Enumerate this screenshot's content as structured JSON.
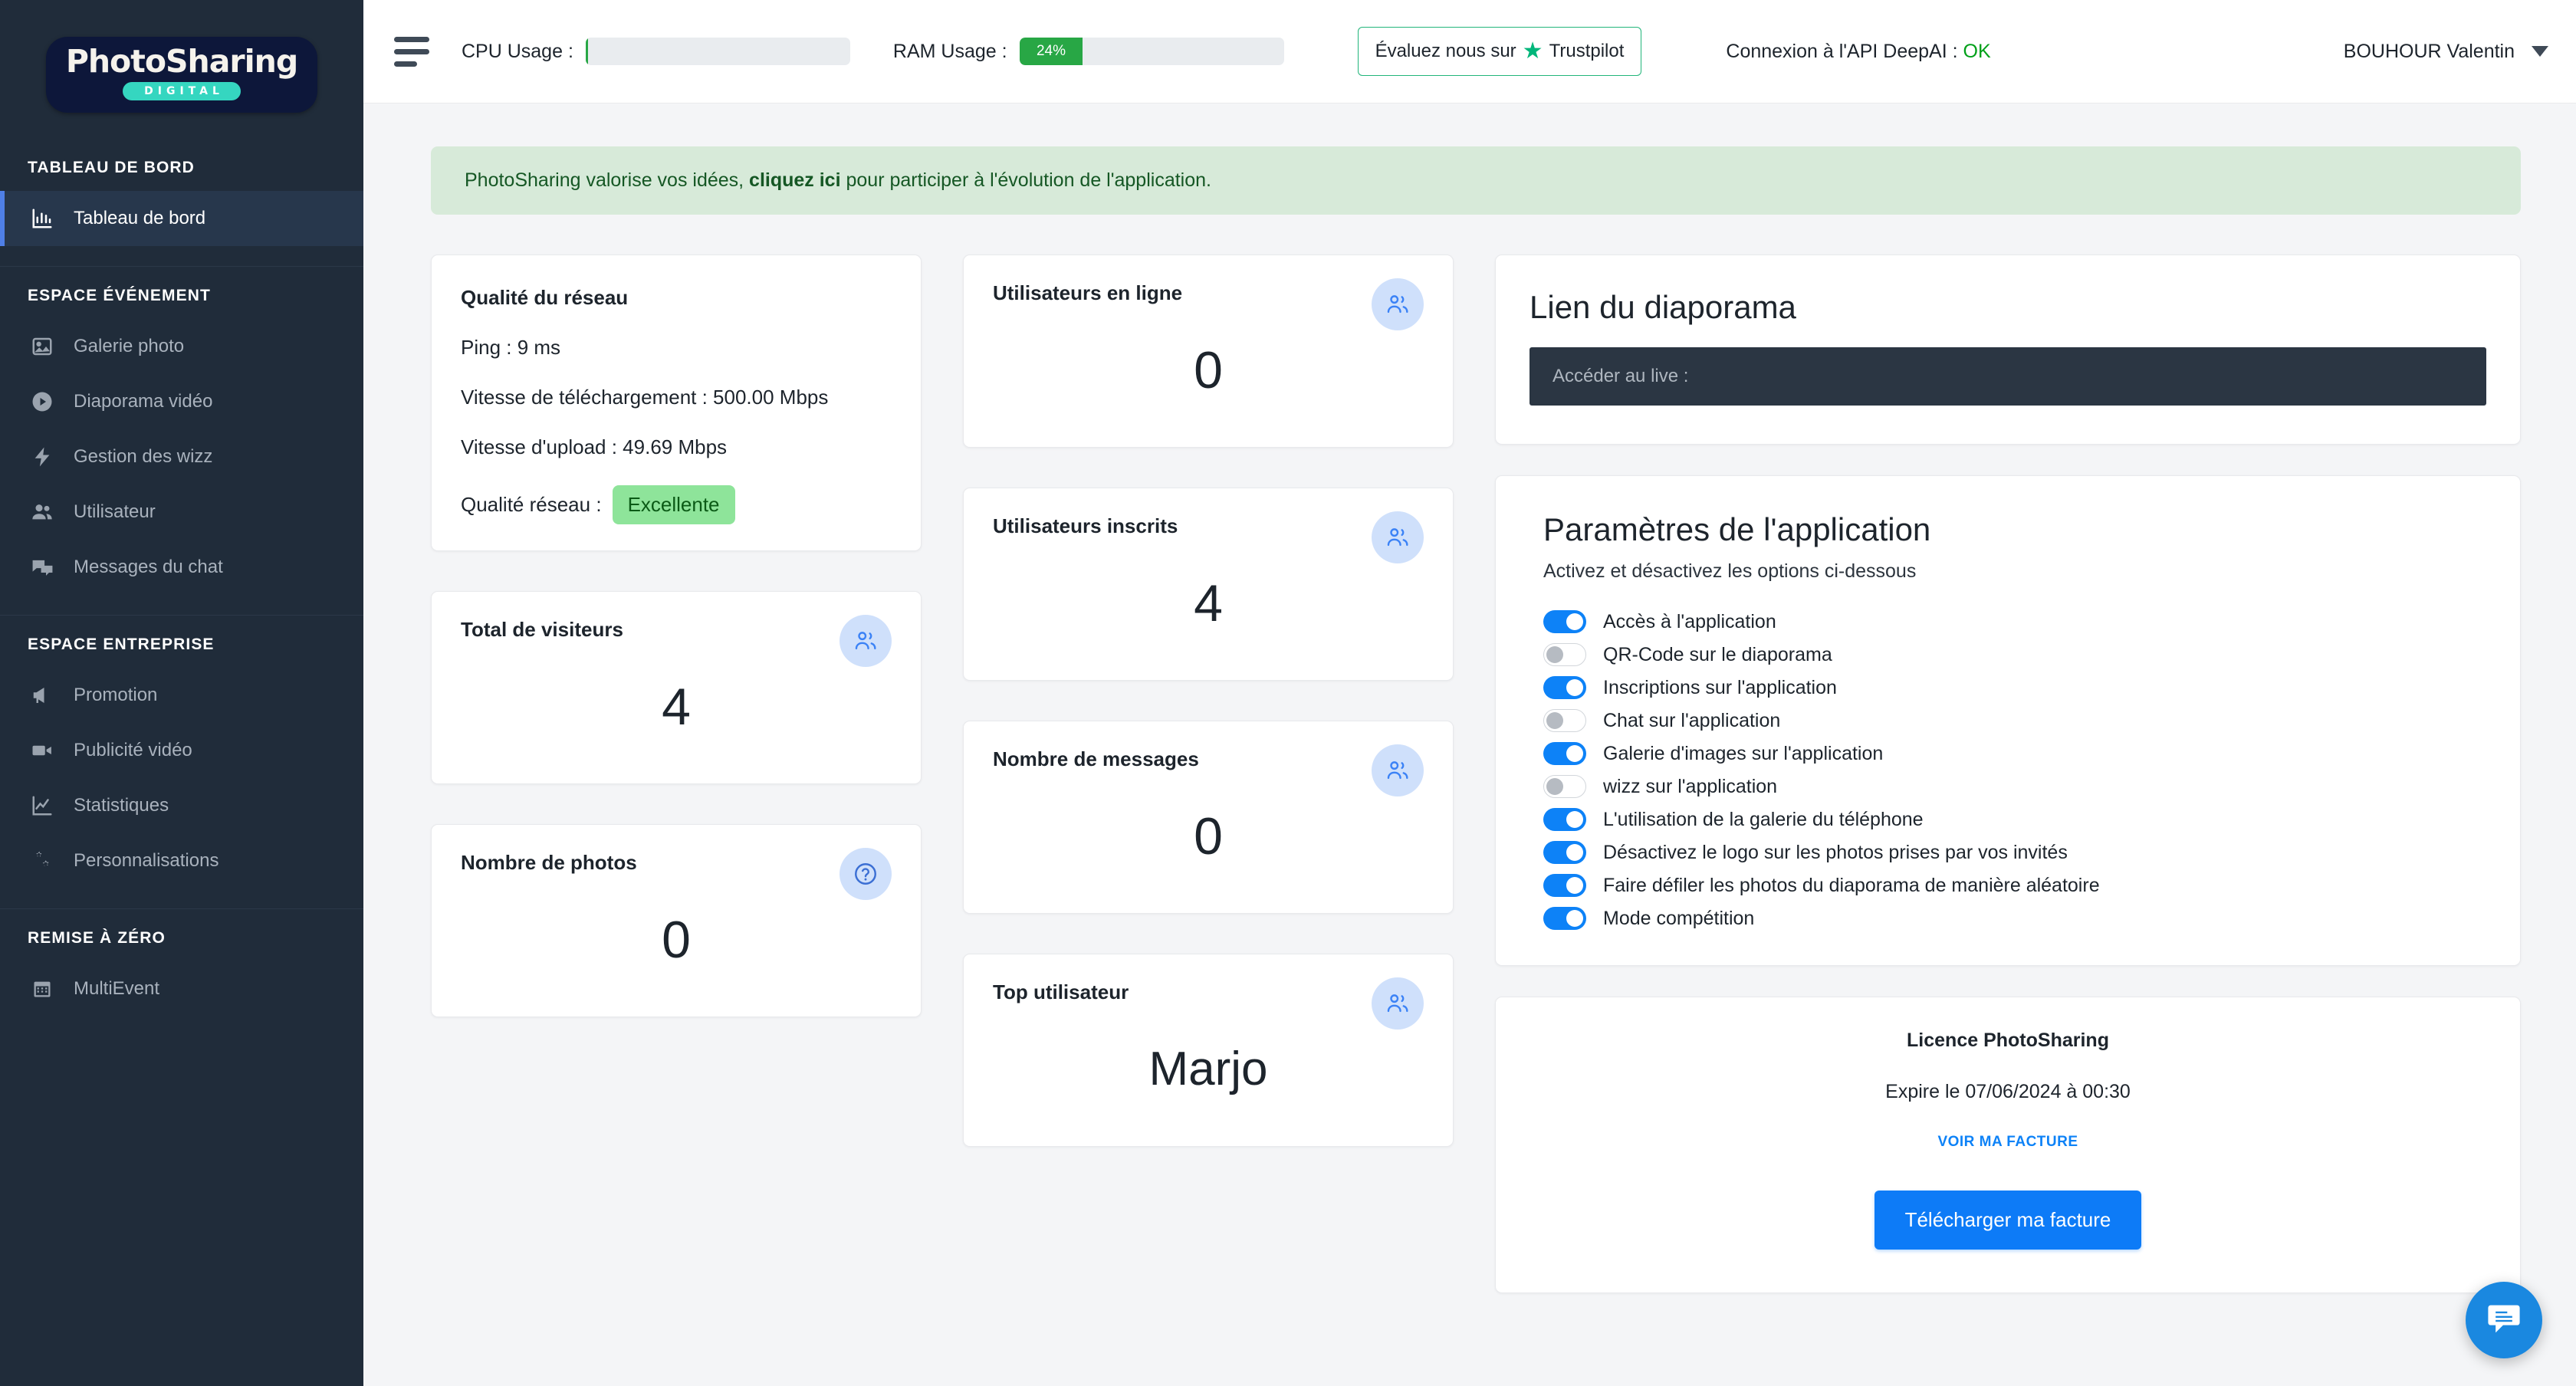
{
  "brand": {
    "logo_main": "PhotoSharing",
    "logo_sub": "DIGITAL"
  },
  "sidebar": {
    "sections": [
      {
        "title": "TABLEAU DE BORD",
        "items": [
          {
            "label": "Tableau de bord",
            "icon": "bar-chart-icon",
            "active": true
          }
        ]
      },
      {
        "title": "ESPACE ÉVÉNEMENT",
        "items": [
          {
            "label": "Galerie photo",
            "icon": "image-icon",
            "active": false
          },
          {
            "label": "Diaporama vidéo",
            "icon": "play-circle-icon",
            "active": false
          },
          {
            "label": "Gestion des wizz",
            "icon": "bolt-icon",
            "active": false
          },
          {
            "label": "Utilisateur",
            "icon": "users-icon",
            "active": false
          },
          {
            "label": "Messages du chat",
            "icon": "chat-bubbles-icon",
            "active": false
          }
        ]
      },
      {
        "title": "ESPACE ENTREPRISE",
        "items": [
          {
            "label": "Promotion",
            "icon": "megaphone-icon",
            "active": false
          },
          {
            "label": "Publicité vidéo",
            "icon": "video-camera-icon",
            "active": false
          },
          {
            "label": "Statistiques",
            "icon": "line-chart-icon",
            "active": false
          },
          {
            "label": "Personnalisations",
            "icon": "gears-icon",
            "active": false
          }
        ]
      },
      {
        "title": "REMISE À ZÉRO",
        "items": [
          {
            "label": "MultiEvent",
            "icon": "calendar-icon",
            "active": false
          }
        ]
      }
    ]
  },
  "topbar": {
    "menu_icon": "hamburger-icon",
    "cpu": {
      "label": "CPU Usage :",
      "value": "",
      "percent": 1
    },
    "ram": {
      "label": "RAM Usage :",
      "value": "24%",
      "percent": 24
    },
    "trustpilot": {
      "text_before": "Évaluez nous sur",
      "star": "★",
      "brand": "Trustpilot"
    },
    "api": {
      "label": "Connexion à l'API DeepAI :",
      "status": "OK"
    },
    "user": {
      "name": "BOUHOUR Valentin",
      "caret_icon": "chevron-down-icon"
    }
  },
  "banner": {
    "text_before": "PhotoSharing valorise vos idées, ",
    "link": "cliquez ici",
    "text_after": " pour participer à l'évolution de l'application."
  },
  "network": {
    "title": "Qualité du réseau",
    "ping": "Ping : 9 ms",
    "download": "Vitesse de téléchargement : 500.00 Mbps",
    "upload": "Vitesse d'upload : 49.69 Mbps",
    "quality_label": "Qualité réseau :",
    "quality_value": "Excellente"
  },
  "stats_left": [
    {
      "title": "Total de visiteurs",
      "value": "4",
      "icon": "users-icon"
    },
    {
      "title": "Nombre de photos",
      "value": "0",
      "icon": "question-circle-icon"
    }
  ],
  "stats_mid": [
    {
      "title": "Utilisateurs en ligne",
      "value": "0",
      "icon": "users-icon"
    },
    {
      "title": "Utilisateurs inscrits",
      "value": "4",
      "icon": "users-icon"
    },
    {
      "title": "Nombre de messages",
      "value": "0",
      "icon": "users-icon"
    },
    {
      "title": "Top utilisateur",
      "value": "Marjo",
      "icon": "users-icon"
    }
  ],
  "slideshow": {
    "title": "Lien du diaporama",
    "field_text": "Accéder au live :"
  },
  "settings": {
    "title": "Paramètres de l'application",
    "subtitle": "Activez et désactivez les options ci-dessous",
    "options": [
      {
        "label": "Accès à l'application",
        "on": true
      },
      {
        "label": "QR-Code sur le diaporama",
        "on": false
      },
      {
        "label": "Inscriptions sur l'application",
        "on": true
      },
      {
        "label": "Chat sur l'application",
        "on": false
      },
      {
        "label": "Galerie d'images sur l'application",
        "on": true
      },
      {
        "label": "wizz sur l'application",
        "on": false
      },
      {
        "label": "L'utilisation de la galerie du téléphone",
        "on": true
      },
      {
        "label": "Désactivez le logo sur les photos prises par vos invités",
        "on": true
      },
      {
        "label": "Faire défiler les photos du diaporama de manière aléatoire",
        "on": true
      },
      {
        "label": "Mode compétition",
        "on": true
      }
    ]
  },
  "licence": {
    "title": "Licence PhotoSharing",
    "expiry": "Expire le 07/06/2024 à 00:30",
    "link": "VOIR MA FACTURE",
    "button": "Télécharger ma facture"
  },
  "fab": {
    "icon": "chat-icon"
  },
  "colors": {
    "sidebar_bg": "#202c3a",
    "accent_blue": "#0d82f7",
    "success_green": "#28a745",
    "trustpilot_green": "#00b67a",
    "banner_bg": "#d7ead9"
  }
}
